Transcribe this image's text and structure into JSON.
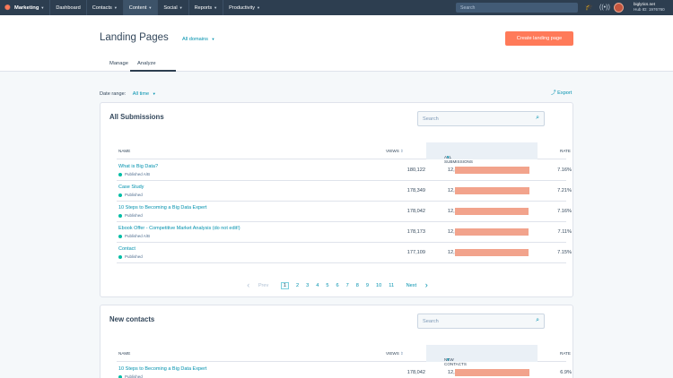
{
  "topnav": {
    "brand": "Marketing",
    "items": [
      {
        "label": "Dashboard",
        "caret": false,
        "active": false
      },
      {
        "label": "Contacts",
        "caret": true,
        "active": false
      },
      {
        "label": "Content",
        "caret": true,
        "active": true
      },
      {
        "label": "Social",
        "caret": true,
        "active": false
      },
      {
        "label": "Reports",
        "caret": true,
        "active": false
      },
      {
        "label": "Productivity",
        "caret": true,
        "active": false
      }
    ],
    "search_placeholder": "Search",
    "account_name": "biglytics.net",
    "hub_id": "Hub ID: 1976760"
  },
  "header": {
    "title": "Landing Pages",
    "domains": "All domains",
    "create_button": "Create landing page",
    "tabs": [
      "Manage",
      "Analyze"
    ],
    "active_tab": "Analyze"
  },
  "filters": {
    "date_range_label": "Date range:",
    "date_range_value": "All time",
    "export_label": "Export"
  },
  "submissions": {
    "title": "All Submissions",
    "search_placeholder": "Search",
    "columns": {
      "name": "Name",
      "views": "Views",
      "metric": "All Submissions",
      "rate": "Rate"
    },
    "rows": [
      {
        "name": "What is Big Data?",
        "status": "Published A/B",
        "views": "180,122",
        "value": "12,893",
        "bar": 1.0,
        "rate": "7.16%"
      },
      {
        "name": "Case Study",
        "status": "Published",
        "views": "178,349",
        "value": "12,856",
        "bar": 0.997,
        "rate": "7.21%"
      },
      {
        "name": "10 Steps to Becoming a Big Data Expert",
        "status": "Published",
        "views": "178,042",
        "value": "12,741",
        "bar": 0.988,
        "rate": "7.16%"
      },
      {
        "name": "Ebook Offer - Competitive Market Analysis (do not edit!)",
        "status": "Published A/B",
        "views": "178,173",
        "value": "12,664",
        "bar": 0.982,
        "rate": "7.11%"
      },
      {
        "name": "Contact",
        "status": "Published",
        "views": "177,109",
        "value": "12,655",
        "bar": 0.982,
        "rate": "7.15%"
      }
    ],
    "pagination": {
      "prev": "Prev",
      "pages": [
        "1",
        "2",
        "3",
        "4",
        "5",
        "6",
        "7",
        "8",
        "9",
        "10",
        "11"
      ],
      "current": "1",
      "next": "Next"
    }
  },
  "new_contacts": {
    "title": "New contacts",
    "search_placeholder": "Search",
    "columns": {
      "name": "Name",
      "views": "Views",
      "metric": "New Contacts",
      "rate": "Rate"
    },
    "rows": [
      {
        "name": "10 Steps to Becoming a Big Data Expert",
        "status": "Published",
        "views": "178,042",
        "value": "12,284",
        "bar": 1.0,
        "rate": "6.9%"
      }
    ]
  },
  "colors": {
    "accent": "#ff7a59",
    "link": "#0091ae",
    "nav": "#2d3e50",
    "bar": "#f2a38c",
    "status_dot": "#00bda5"
  }
}
